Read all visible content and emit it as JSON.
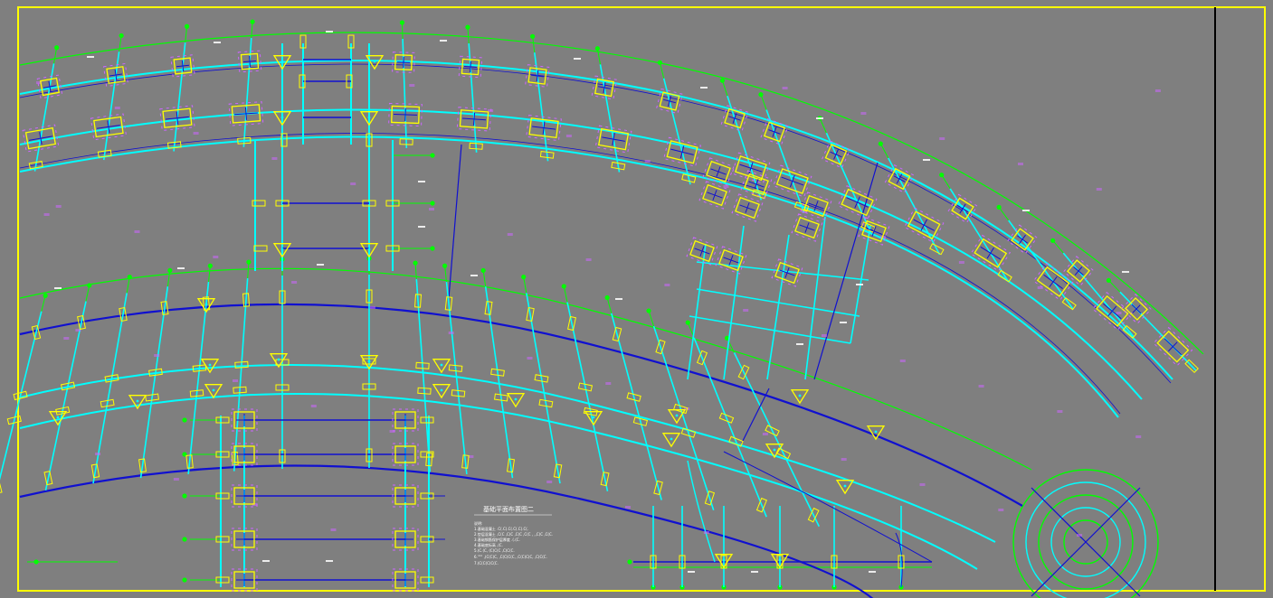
{
  "colors": {
    "background": "#7f7f7f",
    "frame": "#ffff00",
    "axis_green": "#00ff00",
    "beam_cyan": "#00ffff",
    "beam_blue": "#1010d0",
    "column_yellow": "#ffff00",
    "rebar_magenta": "#cc66ff",
    "text_white": "#ffffff",
    "divider": "#000000"
  },
  "drawing": {
    "notes_title": "基础平面布置图二",
    "notes_lines": [
      "说明:",
      "1.基础混凝土 .C(.C(.C(.C(.C(.C(.",
      "2.垫层混凝土 ,C(C ,C(C ,C(C ,C(C , ,,C(C ,C(C.",
      "3.基础钢筋保护层厚度 .(.(C.",
      "4.基础底标高 ,(C.",
      "5.(C.(C, (C(C(C ,C(C(C.",
      "6.\"\"\" ,(C(C(C, ,C(C(C(C, ,C(C(C(C, ,C(C(C.",
      "7.(C(C(C(C(C."
    ],
    "legend_icons": [
      "axis-bubble-icon",
      "column-footing-icon",
      "triangular-pile-cap-icon"
    ]
  }
}
